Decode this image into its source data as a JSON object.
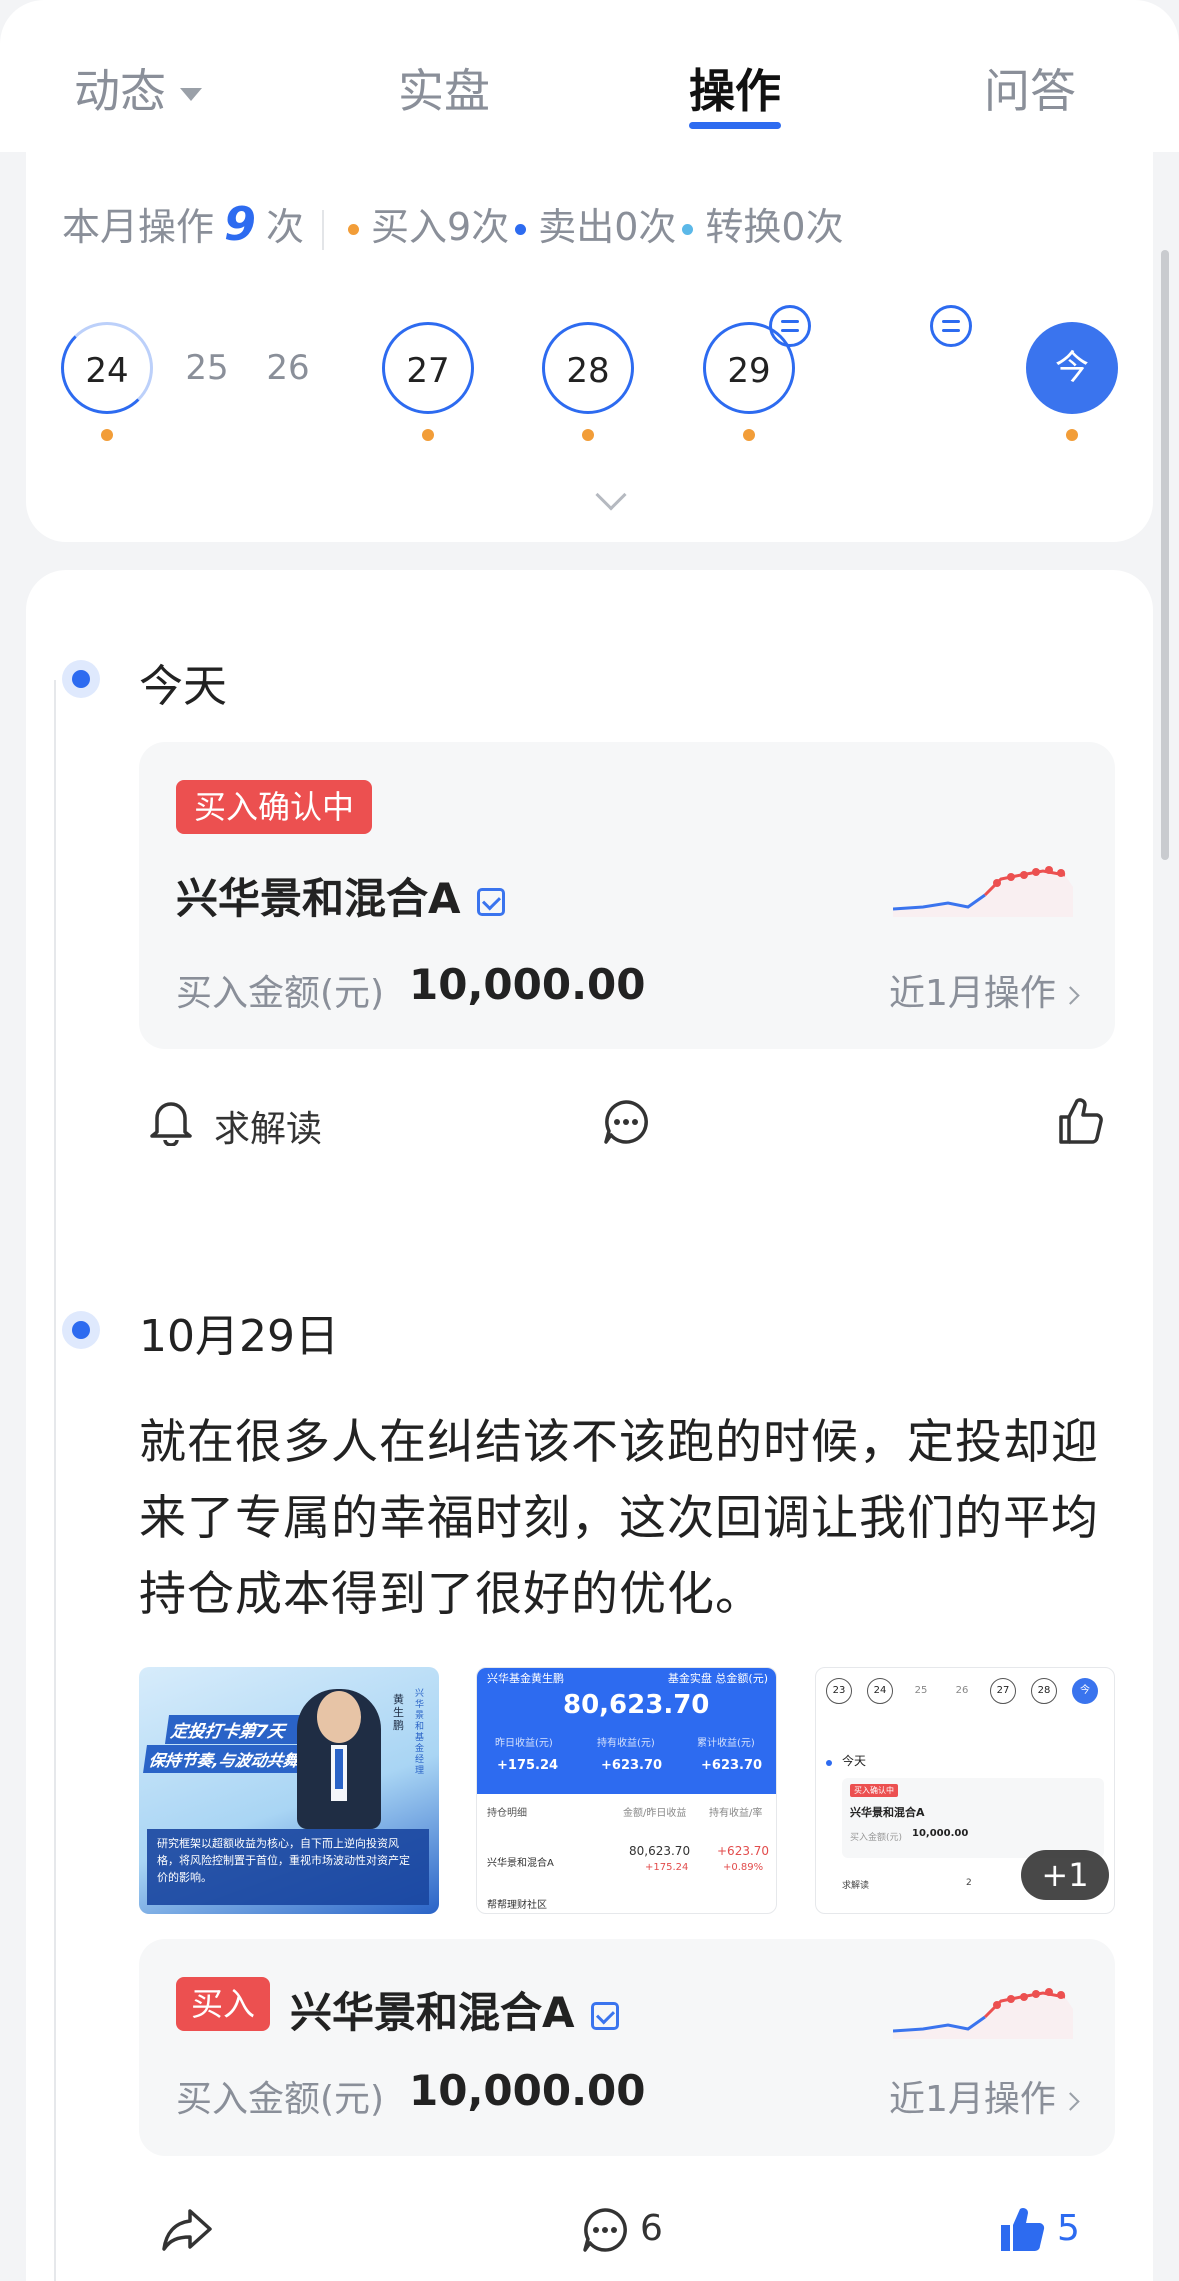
{
  "tabs": [
    {
      "label": "动态",
      "has_dropdown": true
    },
    {
      "label": "实盘"
    },
    {
      "label": "操作",
      "active": true
    },
    {
      "label": "问答"
    }
  ],
  "summary": {
    "prefix": "本月操作",
    "count": "9",
    "suffix": "次",
    "buy": "买入9次",
    "sell": "卖出0次",
    "convert": "转换0次",
    "colors": {
      "buy": "#f29d38",
      "sell": "#2d6bf0",
      "convert": "#5bb8e8"
    }
  },
  "calendar": {
    "days": [
      {
        "label": "24",
        "style": "half",
        "has_op": true,
        "has_comment": false
      },
      {
        "label": "25",
        "style": "plain",
        "has_op": false,
        "has_comment": false
      },
      {
        "label": "26",
        "style": "plain",
        "has_op": false,
        "has_comment": false
      },
      {
        "label": "27",
        "style": "outlined",
        "has_op": true,
        "has_comment": false
      },
      {
        "label": "28",
        "style": "outlined",
        "has_op": true,
        "has_comment": true
      },
      {
        "label": "29",
        "style": "outlined",
        "has_op": true,
        "has_comment": true
      },
      {
        "label": "今",
        "style": "today",
        "has_op": true,
        "has_comment": false
      }
    ],
    "expand_icon": "chevron-down-icon"
  },
  "entries": [
    {
      "date": "今天",
      "card": {
        "tag": "买入确认中",
        "fund_name": "兴华景和混合A",
        "amount_label": "买入金额(元)",
        "amount": "10,000.00",
        "recent": "近1月操作"
      },
      "actions": {
        "ask": "求解读",
        "comment_icon": "comment-icon",
        "like_icon": "thumbs-up-icon"
      }
    },
    {
      "date": "10月29日",
      "post_text": "就在很多人在纠结该不该跑的时候，定投却迎来了专属的幸福时刻，这次回调让我们的平均持仓成本得到了很好的优化。",
      "images": {
        "img1": {
          "headline1": "定投打卡第7天",
          "headline2": "保持节奏,与波动共舞",
          "name": "黄生鹏",
          "side_text": "兴华景和基金经理",
          "caption": "研究框架以超额收益为核心，自下而上逆向投资风格，将风险控制置于首位，重视市场波动性对资产定价的影响。"
        },
        "img2": {
          "header_left": "兴华基金黄生鹏",
          "header_right": "基金实盘 总金额(元)",
          "total": "80,623.70",
          "stats": [
            {
              "label": "昨日收益(元)",
              "value": "+175.24"
            },
            {
              "label": "持有收益(元)",
              "value": "+623.70"
            },
            {
              "label": "累计收益(元)",
              "value": "+623.70"
            }
          ],
          "col1": "持仓明细",
          "col2": "金额/昨日收益",
          "col3": "持有收益/率",
          "row_name": "兴华景和混合A",
          "row_amount": "80,623.70",
          "row_day": "+175.24",
          "row_hold": "+623.70",
          "row_rate": "+0.89%",
          "footer": "帮帮理财社区"
        },
        "img3": {
          "days": [
            "23",
            "24",
            "25",
            "26",
            "27",
            "28",
            "今"
          ],
          "today": "今天",
          "tag": "买入确认中",
          "fund": "兴华景和混合A",
          "amount_label": "买入金额(元)",
          "amount": "10,000.00",
          "ask": "求解读",
          "comments": "2"
        },
        "more": "+1"
      },
      "card": {
        "tag": "买入",
        "fund_name": "兴华景和混合A",
        "amount_label": "买入金额(元)",
        "amount": "10,000.00",
        "recent": "近1月操作"
      },
      "actions": {
        "share_icon": "share-icon",
        "comment_count": "6",
        "like_count": "5"
      }
    }
  ]
}
